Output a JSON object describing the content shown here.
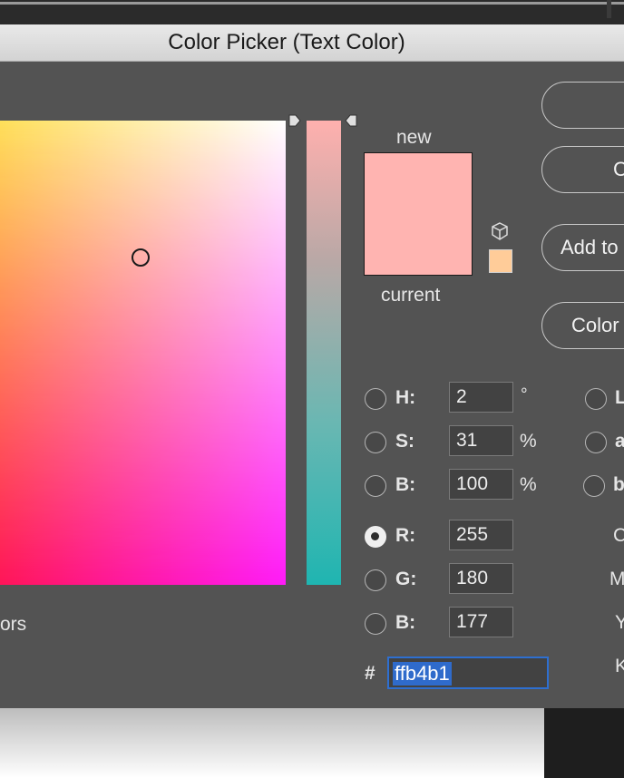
{
  "window": {
    "title": "Color Picker (Text Color)"
  },
  "swatches": {
    "new_label": "new",
    "current_label": "current",
    "new_color": "#ffb4b1",
    "websafe_color": "#ffcc99"
  },
  "left_partial_label": "ors",
  "buttons": {
    "ok_partial": "",
    "cancel_partial": "C",
    "add_partial": "Add to",
    "libraries_partial": "Color"
  },
  "hsb": {
    "h": {
      "label": "H:",
      "value": "2",
      "unit": "°"
    },
    "s": {
      "label": "S:",
      "value": "31",
      "unit": "%"
    },
    "b": {
      "label": "B:",
      "value": "100",
      "unit": "%"
    }
  },
  "rgb": {
    "r": {
      "label": "R:",
      "value": "255"
    },
    "g": {
      "label": "G:",
      "value": "180"
    },
    "b": {
      "label": "B:",
      "value": "177"
    }
  },
  "lab_partial": {
    "l": "L",
    "a": "a",
    "b": "b"
  },
  "cmyk_partial": {
    "c": "C",
    "m": "M",
    "y": "Y",
    "k": "K"
  },
  "hex": {
    "label": "#",
    "value": "ffb4b1"
  },
  "icons": {
    "cube": "cube-icon",
    "arrow": "slider-arrow-icon"
  }
}
